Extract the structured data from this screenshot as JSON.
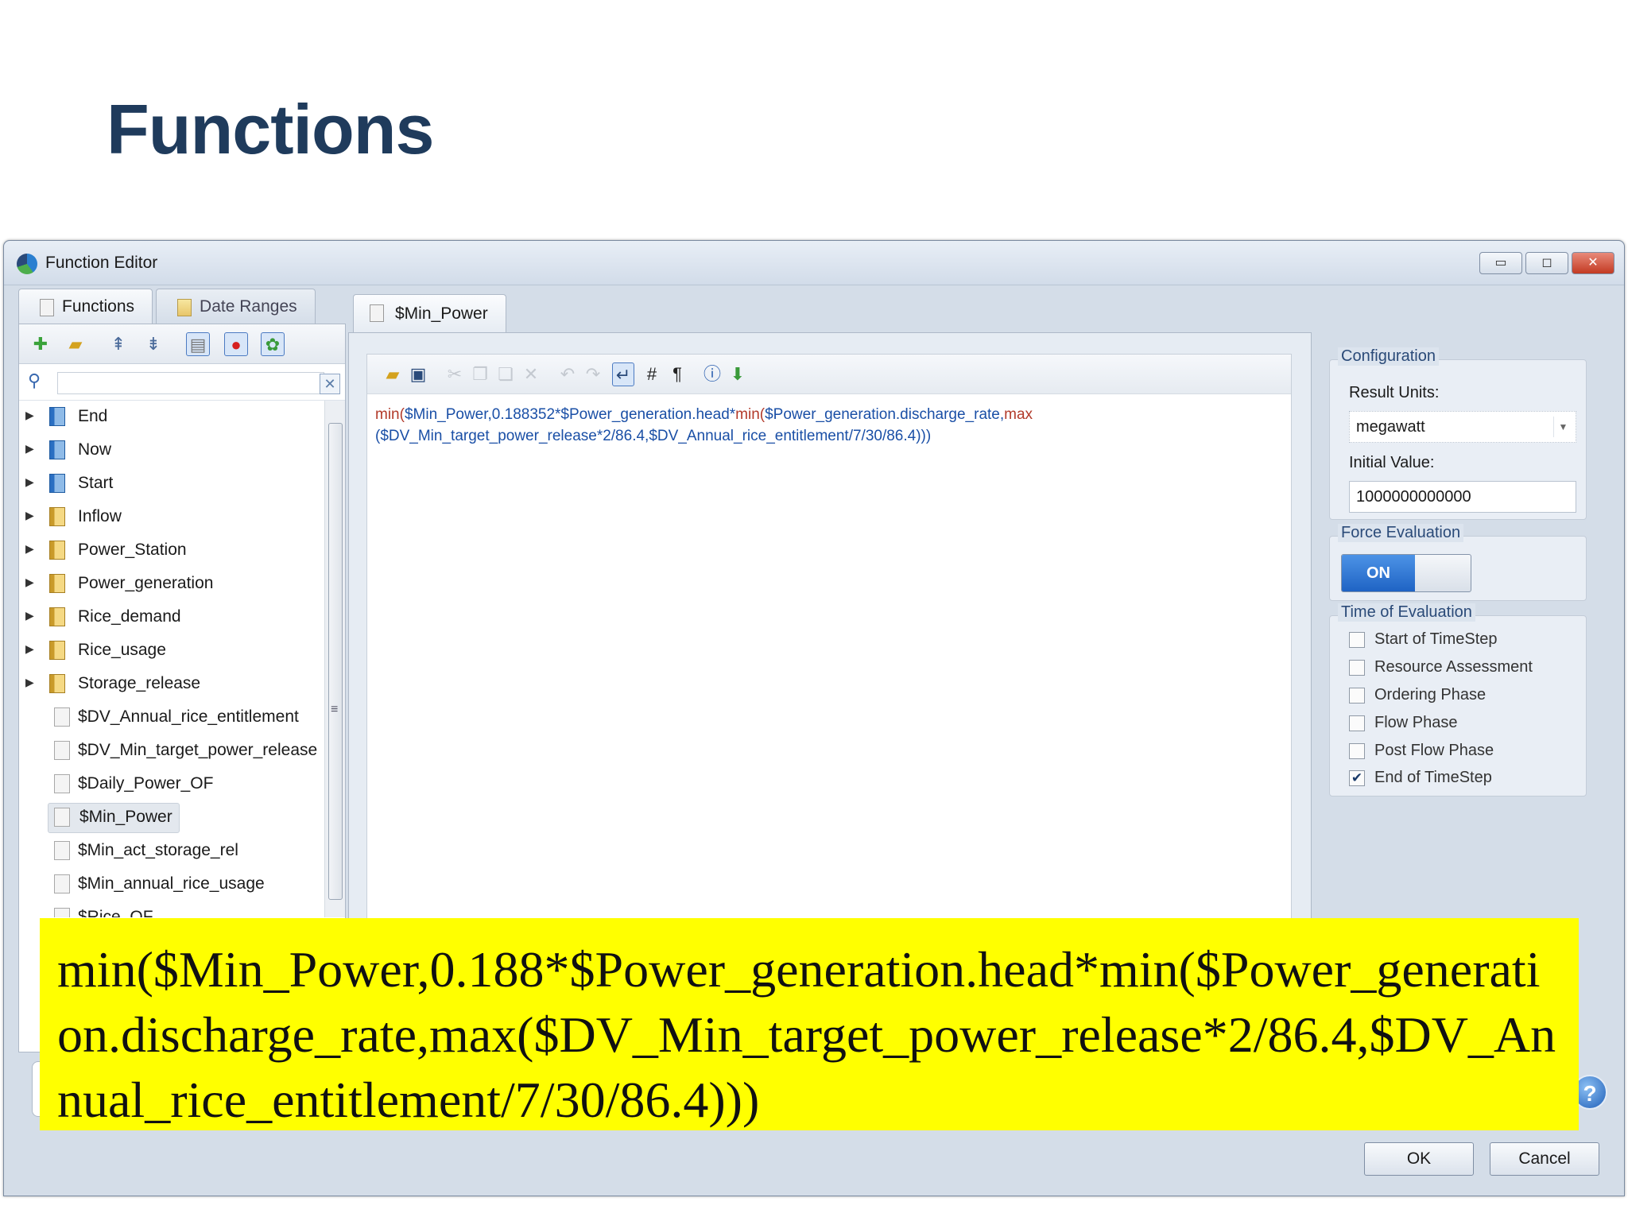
{
  "slide": {
    "title": "Functions"
  },
  "window": {
    "title": "Function Editor",
    "controls": {
      "minimize": "▭",
      "maximize": "◻",
      "close": "✕"
    }
  },
  "left_panel": {
    "tabs": [
      {
        "label": "Functions",
        "active": true
      },
      {
        "label": "Date Ranges",
        "active": false
      }
    ],
    "toolbar_icons": [
      "add-icon",
      "open-folder-icon",
      "expand-all-icon",
      "collapse-all-icon",
      "document-icon",
      "record-icon",
      "settings-icon"
    ],
    "tree_items": [
      {
        "label": "End",
        "icon": "blue-folder",
        "expandable": true
      },
      {
        "label": "Now",
        "icon": "blue-folder",
        "expandable": true
      },
      {
        "label": "Start",
        "icon": "blue-folder",
        "expandable": true
      },
      {
        "label": "Inflow",
        "icon": "yellow-folder",
        "expandable": true
      },
      {
        "label": "Power_Station",
        "icon": "yellow-folder",
        "expandable": true
      },
      {
        "label": "Power_generation",
        "icon": "yellow-folder",
        "expandable": true
      },
      {
        "label": "Rice_demand",
        "icon": "yellow-folder",
        "expandable": true
      },
      {
        "label": "Rice_usage",
        "icon": "yellow-folder",
        "expandable": true
      },
      {
        "label": "Storage_release",
        "icon": "yellow-folder",
        "expandable": true
      },
      {
        "label": "$DV_Annual_rice_entitlement",
        "icon": "document",
        "expandable": false
      },
      {
        "label": "$DV_Min_target_power_release",
        "icon": "document",
        "expandable": false
      },
      {
        "label": "$Daily_Power_OF",
        "icon": "document",
        "expandable": false
      },
      {
        "label": "$Min_Power",
        "icon": "document",
        "expandable": false,
        "selected": true
      },
      {
        "label": "$Min_act_storage_rel",
        "icon": "document",
        "expandable": false
      },
      {
        "label": "$Min_annual_rice_usage",
        "icon": "document",
        "expandable": false
      },
      {
        "label": "$Rice_OF",
        "icon": "document",
        "expandable": false
      }
    ]
  },
  "editor": {
    "tab_label": "$Min_Power",
    "code": {
      "p1": "min(",
      "p2": "$Min_Power,0.188352*$Power_generation.head*",
      "p3": "min(",
      "p4": "$Power_generation.discharge_rate,",
      "p5": "max",
      "p6": "($DV_Min_target_power_release*2/86.4,$DV_Annual_rice_entitlement/7/30/86.4)))"
    }
  },
  "configuration": {
    "title": "Configuration",
    "result_units_label": "Result Units:",
    "result_units_value": "megawatt",
    "initial_value_label": "Initial Value:",
    "initial_value": "1000000000000",
    "force_evaluation_title": "Force Evaluation",
    "force_evaluation_state": "ON",
    "time_of_evaluation_title": "Time of Evaluation",
    "time_options": [
      {
        "label": "Start of TimeStep",
        "checked": false
      },
      {
        "label": "Resource Assessment",
        "checked": false
      },
      {
        "label": "Ordering Phase",
        "checked": false
      },
      {
        "label": "Flow Phase",
        "checked": false
      },
      {
        "label": "Post Flow Phase",
        "checked": false
      },
      {
        "label": "End of TimeStep",
        "checked": true
      }
    ]
  },
  "buttons": {
    "ok": "OK",
    "cancel": "Cancel",
    "help": "?"
  },
  "overlay": {
    "text": "min($Min_Power,0.188*$Power_generation.head*min($Power_generation.discharge_rate,max($DV_Min_target_power_release*2/86.4,$DV_Annual_rice_entitlement/7/30/86.4)))",
    "background": "#ffff00"
  },
  "colors": {
    "title": "#1f3b5c",
    "code_blue": "#1a4fa6",
    "code_red": "#b23a2a",
    "toggle_on": "#1f63c4"
  }
}
